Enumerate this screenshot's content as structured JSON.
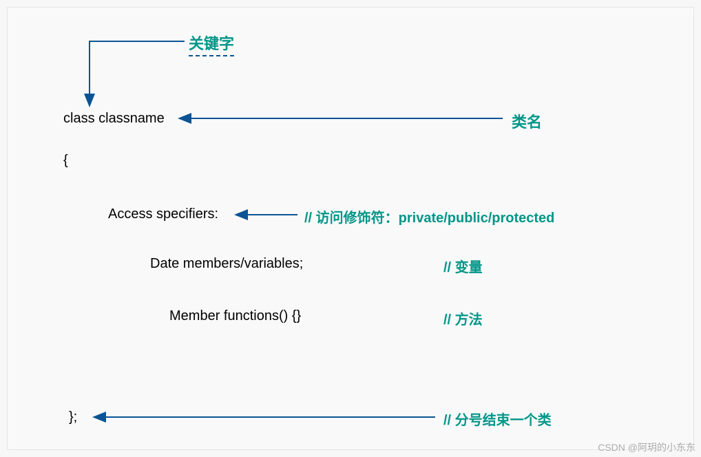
{
  "labels": {
    "keyword": "关键字",
    "classname": "类名",
    "access_comment": "// 访问修饰符：private/public/protected",
    "variables_comment": "// 变量",
    "methods_comment": "// 方法",
    "semicolon_comment": "// 分号结束一个类"
  },
  "code": {
    "class_decl": "class classname",
    "open_brace": "{",
    "access_specifiers": "Access specifiers:",
    "data_members": "Date members/variables;",
    "member_functions": "Member functions() {}",
    "close_brace": "};"
  },
  "watermark": "CSDN @阿玥的小东东"
}
